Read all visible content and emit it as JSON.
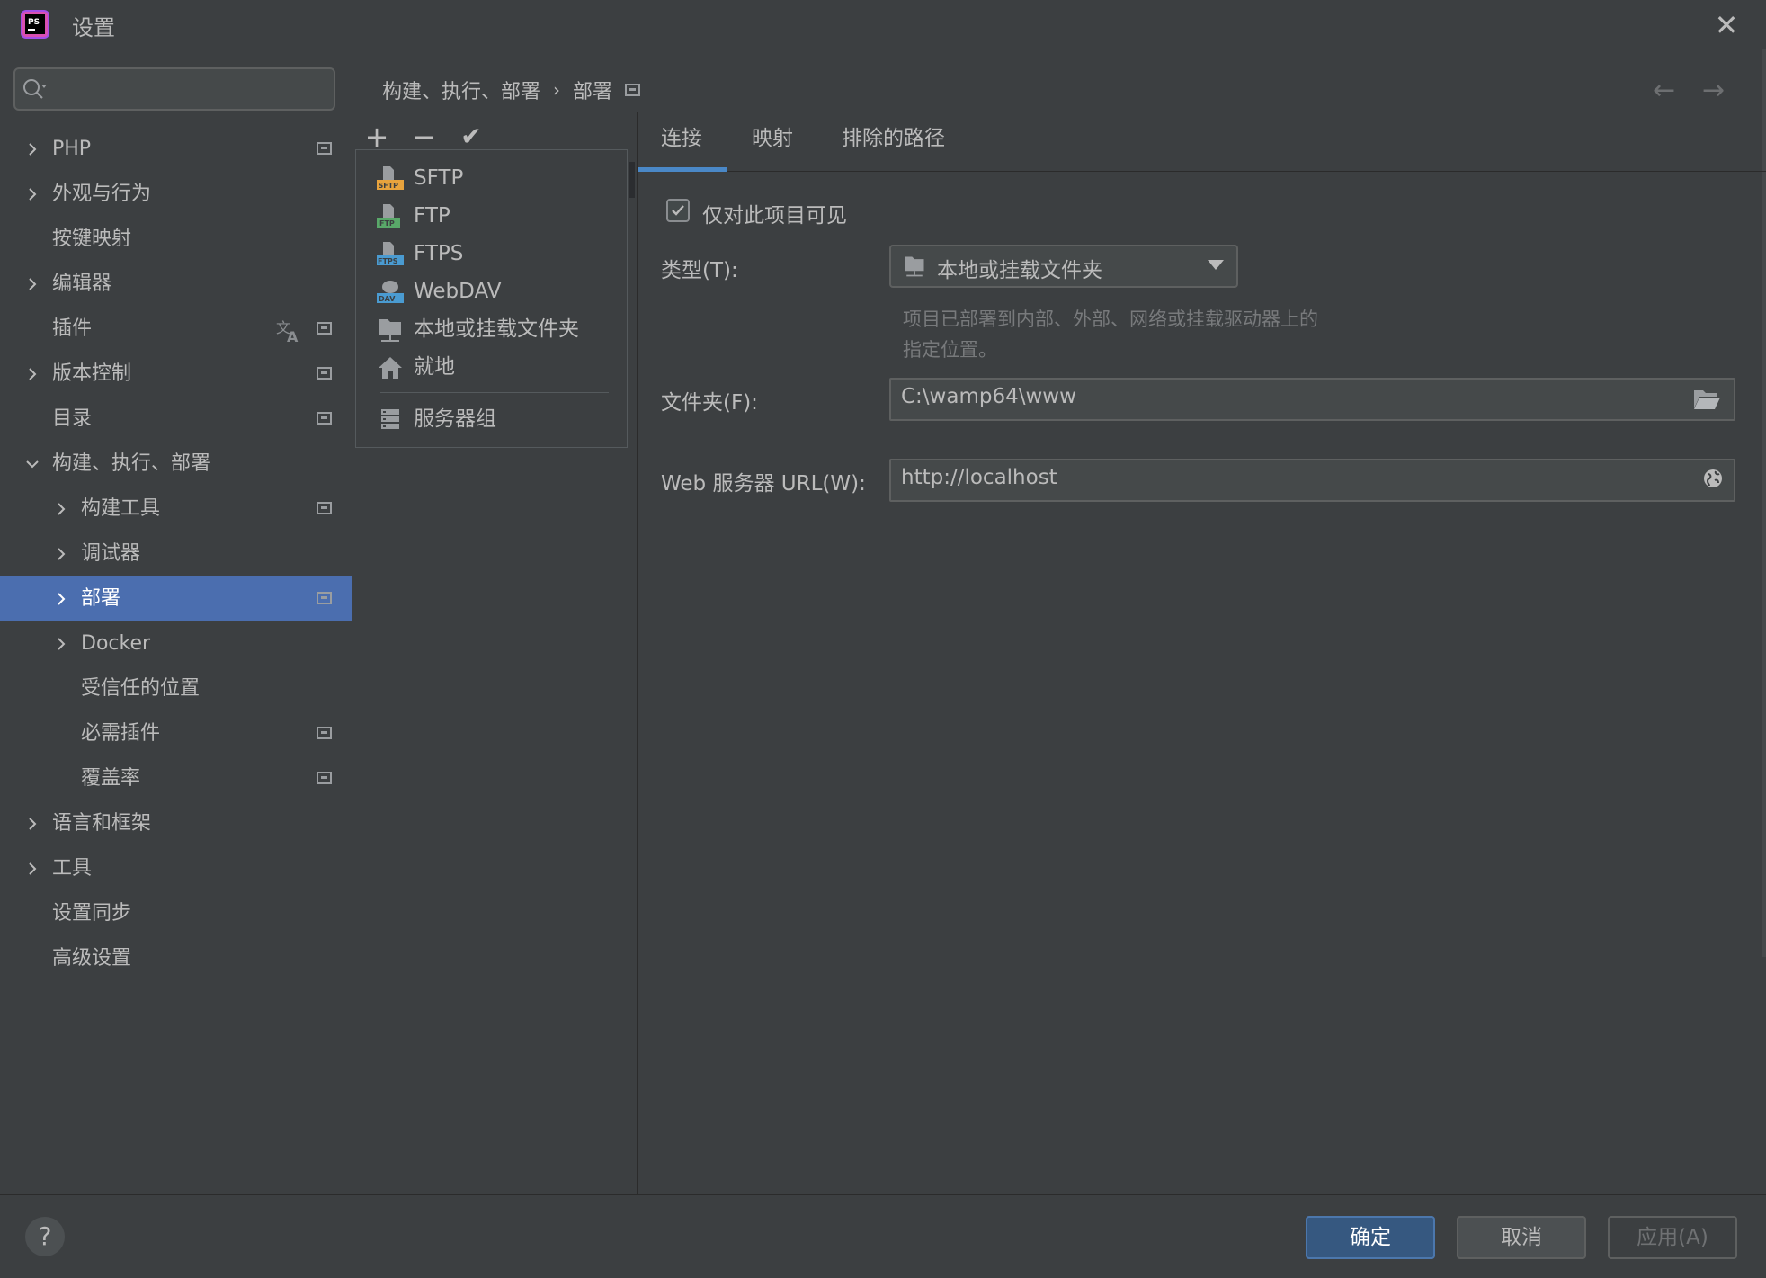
{
  "window": {
    "title": "设置"
  },
  "sidebar": {
    "search": {
      "placeholder": ""
    },
    "items": [
      {
        "label": "PHP"
      },
      {
        "label": "外观与行为"
      },
      {
        "label": "按键映射"
      },
      {
        "label": "编辑器"
      },
      {
        "label": "插件"
      },
      {
        "label": "版本控制"
      },
      {
        "label": "目录"
      },
      {
        "label": "构建、执行、部署"
      },
      {
        "label": "构建工具"
      },
      {
        "label": "调试器"
      },
      {
        "label": "部署"
      },
      {
        "label": "Docker"
      },
      {
        "label": "受信任的位置"
      },
      {
        "label": "必需插件"
      },
      {
        "label": "覆盖率"
      },
      {
        "label": "语言和框架"
      },
      {
        "label": "工具"
      },
      {
        "label": "设置同步"
      },
      {
        "label": "高级设置"
      }
    ]
  },
  "breadcrumb": {
    "parent": "构建、执行、部署",
    "separator": "›",
    "current": "部署"
  },
  "toolbar": {
    "add": "+",
    "remove": "−",
    "check": "✔"
  },
  "popup": {
    "items": [
      {
        "label": "SFTP",
        "icon": "sftp-icon"
      },
      {
        "label": "FTP",
        "icon": "ftp-icon"
      },
      {
        "label": "FTPS",
        "icon": "ftps-icon"
      },
      {
        "label": "WebDAV",
        "icon": "webdav-icon"
      },
      {
        "label": "本地或挂载文件夹",
        "icon": "local-folder-icon"
      },
      {
        "label": "就地",
        "icon": "home-icon"
      },
      {
        "label": "服务器组",
        "icon": "server-group-icon"
      }
    ]
  },
  "tabs": [
    {
      "label": "连接"
    },
    {
      "label": "映射"
    },
    {
      "label": "排除的路径"
    }
  ],
  "form": {
    "visible_only_label": "仅对此项目可见",
    "type_label": "类型(T):",
    "type_value": "本地或挂载文件夹",
    "type_hint_line1": "项目已部署到内部、外部、网络或挂载驱动器上的",
    "type_hint_line2": "指定位置。",
    "folder_label": "文件夹(F):",
    "folder_value": "C:\\wamp64\\www",
    "url_label": "Web 服务器 URL(W):",
    "url_value": "http://localhost"
  },
  "footer": {
    "help": "?",
    "ok": "确定",
    "cancel": "取消",
    "apply": "应用(A)"
  },
  "colors": {
    "background": "#3c3f41",
    "selection": "#4b6eaf",
    "accent": "#4a88c7",
    "ok_button": "#365880"
  }
}
